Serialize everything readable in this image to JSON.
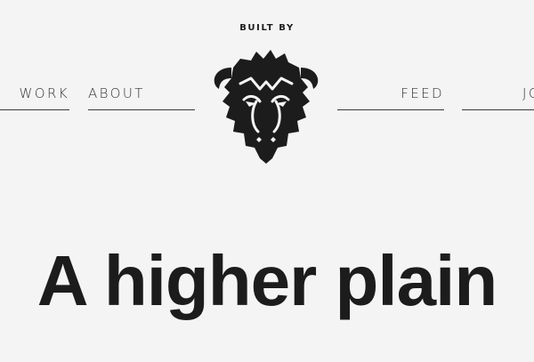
{
  "header": {
    "built_by": "BUILT BY",
    "logo_icon": "bison-head-icon"
  },
  "nav": {
    "work_label": "WORK",
    "about_label": "ABOUT",
    "feed_label": "FEED",
    "join_label": "JOIN"
  },
  "hero": {
    "headline": "A higher plain"
  },
  "colors": {
    "background": "#f4f4f4",
    "ink": "#1c1c1c"
  }
}
